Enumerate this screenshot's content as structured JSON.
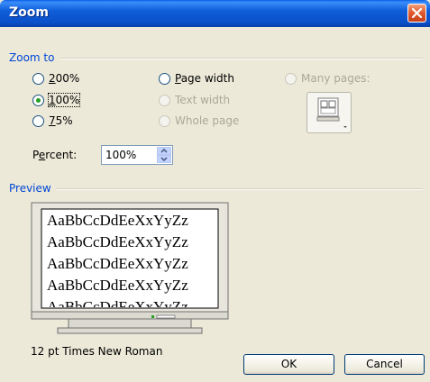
{
  "window": {
    "title": "Zoom"
  },
  "zoom_to": {
    "label": "Zoom to",
    "options": {
      "p200": {
        "label_pre": "",
        "label_u": "2",
        "label_post": "00%",
        "selected": false,
        "enabled": true
      },
      "p100": {
        "label_pre": "",
        "label_u": "1",
        "label_post": "00%",
        "selected": true,
        "enabled": true
      },
      "p75": {
        "label_pre": "",
        "label_u": "7",
        "label_post": "5%",
        "selected": false,
        "enabled": true
      },
      "page_width": {
        "label_pre": "",
        "label_u": "P",
        "label_post": "age width",
        "selected": false,
        "enabled": true
      },
      "text_width": {
        "label": "Text width",
        "enabled": false
      },
      "whole_page": {
        "label": "Whole page",
        "enabled": false
      },
      "many_pages": {
        "label": "Many pages:",
        "enabled": false
      }
    },
    "percent": {
      "label_pre": "P",
      "label_u": "e",
      "label_post": "rcent:",
      "value": "100%"
    }
  },
  "preview": {
    "label": "Preview",
    "sample_lines": [
      "AaBbCcDdEeXxYyZz",
      "AaBbCcDdEeXxYyZz",
      "AaBbCcDdEeXxYyZz",
      "AaBbCcDdEeXxYyZz",
      "AaBbCcDdEeXxYyZz"
    ],
    "font_info": "12 pt Times New Roman"
  },
  "buttons": {
    "ok": "OK",
    "cancel": "Cancel"
  },
  "colors": {
    "titlebar": "#0a5fe6",
    "group_label": "#0046d5",
    "face": "#ece9d8",
    "selected_dot": "#21a121"
  }
}
